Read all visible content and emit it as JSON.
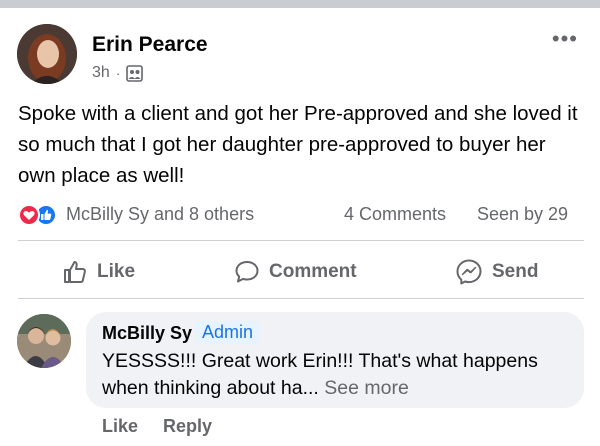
{
  "post": {
    "author": "Erin Pearce",
    "time": "3h",
    "separator": "·",
    "audience_icon": "friends-icon",
    "more_label": "•••",
    "text": "Spoke with a client and got her Pre-approved and she loved it so much that I got her daughter pre-approved to buyer her own place as well!"
  },
  "reactions": {
    "icons": [
      "love-reaction-icon",
      "like-reaction-icon"
    ],
    "names": "McBilly Sy and 8 others",
    "comments": "4 Comments",
    "seen": "Seen by 29"
  },
  "actions": {
    "like": "Like",
    "comment": "Comment",
    "send": "Send"
  },
  "comment": {
    "author": "McBilly Sy",
    "badge": "Admin",
    "text": "YESSSS!!! Great work Erin!!! That's what happens when thinking about ha...",
    "see_more": "See more",
    "like": "Like",
    "reply": "Reply"
  },
  "colors": {
    "accent": "#1877f2",
    "love": "#f0284a",
    "secondary_text": "#65676b",
    "bubble": "#f0f2f5"
  }
}
